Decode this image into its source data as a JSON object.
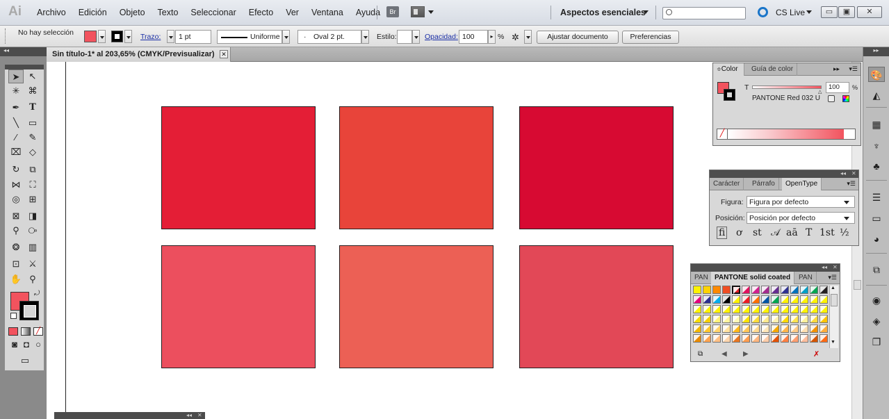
{
  "app": {
    "logo": "Ai",
    "menu": [
      "Archivo",
      "Edición",
      "Objeto",
      "Texto",
      "Seleccionar",
      "Efecto",
      "Ver",
      "Ventana",
      "Ayuda"
    ],
    "bridge_label": "Br",
    "workspace": "Aspectos esenciales",
    "cs_live": "CS Live",
    "win_min": "▭",
    "win_max": "▣",
    "win_close": "✕"
  },
  "control_bar": {
    "selection_status": "No hay selección",
    "stroke_link": "Trazo:",
    "stroke_weight": "1 pt",
    "stroke_profile": "Uniforme",
    "brush": "Oval 2 pt.",
    "style_label": "Estilo:",
    "opacity_link": "Opacidad:",
    "opacity_value": "100",
    "opacity_unit": "%",
    "fit_document_button": "Ajustar documento",
    "preferences_button": "Preferencias",
    "fill_color": "#f2535e"
  },
  "document": {
    "tab_title": "Sin título-1* al 203,65% (CMYK/Previsualizar)",
    "close_glyph": "✕"
  },
  "canvas": {
    "rects": [
      {
        "color": "#e41e36"
      },
      {
        "color": "#e8443a"
      },
      {
        "color": "#d70a32"
      },
      {
        "color": "#ec4f5e"
      },
      {
        "color": "#ec6055"
      },
      {
        "color": "#e24857"
      }
    ]
  },
  "color_panel": {
    "tab_color": "Color",
    "tab_guide": "Guía de color",
    "tint_label": "T",
    "tint_value": "100",
    "tint_unit": "%",
    "color_name": "PANTONE Red 032 U",
    "fill_color": "#f2535e"
  },
  "character_panel": {
    "tab_char": "Carácter",
    "tab_para": "Párrafo",
    "tab_opentype": "OpenType",
    "figura_label": "Figura:",
    "figura_value": "Figura por defecto",
    "posicion_label": "Posición:",
    "posicion_value": "Posición por defecto",
    "glyphs": [
      "ﬁ",
      "ơ",
      "st",
      "𝒜",
      "aā",
      "T",
      "1st",
      "½"
    ]
  },
  "swatch_panel": {
    "tab_left": "PAN",
    "tab_active": "PANTONE solid coated",
    "tab_right": "PAN",
    "row_colors": [
      [
        "#fff200",
        "#ffd200",
        "#ff8a00",
        "#f04e23",
        "#e31e24",
        "#e0115f",
        "#d1208f",
        "#a42b8e",
        "#662d91",
        "#2e3192",
        "#0072bc",
        "#00a0c6",
        "#00a651",
        "#231f20"
      ],
      [
        "#e4007c",
        "#2b2f8f",
        "#00aeef",
        "#000000",
        "#fff200",
        "#ed1c24",
        "#ff6f00",
        "#0054a6",
        "#00a651",
        "#fff200",
        "#fff200",
        "#fff200",
        "#fff200",
        "#fff200"
      ],
      [
        "#fff200",
        "#fff200",
        "#fff200",
        "#fff200",
        "#fff200",
        "#fff200",
        "#fff200",
        "#fff200",
        "#fff200",
        "#fff200",
        "#fff200",
        "#fff200",
        "#fff200",
        "#fff200"
      ],
      [
        "#f7dc00",
        "#f6d000",
        "#fff27a",
        "#fff49e",
        "#fff7b5",
        "#fde200",
        "#fddc3c",
        "#ffe98e",
        "#fff0b0",
        "#ffd800",
        "#ffe34f",
        "#fff09a",
        "#ffd93b",
        "#ffc400"
      ],
      [
        "#f3b800",
        "#ffc72c",
        "#ffd46c",
        "#ffe1a0",
        "#ffb81c",
        "#ffc658",
        "#ffd98f",
        "#ffe6b8",
        "#f5a800",
        "#ffb54a",
        "#ffcb85",
        "#ffdfb1",
        "#f39200",
        "#ffad3b"
      ],
      [
        "#ea8b00",
        "#ffa44f",
        "#ffc085",
        "#ffd5ad",
        "#e87722",
        "#ff9d4f",
        "#ffb67f",
        "#ffcca8",
        "#e35205",
        "#ff7f41",
        "#ff9e70",
        "#ffbd9c",
        "#d45500",
        "#ff6a13"
      ]
    ]
  }
}
